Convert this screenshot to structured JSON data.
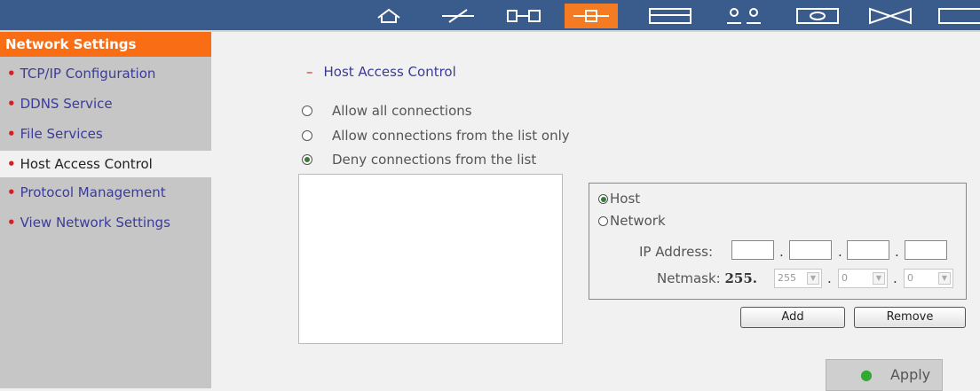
{
  "toolbar": {
    "icons": [
      "home-icon",
      "quick-config-icon",
      "system-settings-icon",
      "network-settings-icon",
      "device-config-icon",
      "user-management-icon",
      "network-share-icon",
      "system-tools-icon",
      "logs-icon"
    ],
    "active_index": 3
  },
  "sidebar": {
    "title": "Network Settings",
    "items": [
      {
        "label": "TCP/IP Configuration"
      },
      {
        "label": "DDNS Service"
      },
      {
        "label": "File Services"
      },
      {
        "label": "Host Access Control"
      },
      {
        "label": "Protocol Management"
      },
      {
        "label": "View Network Settings"
      }
    ],
    "active_index": 3
  },
  "main": {
    "title": "Host Access Control",
    "options": [
      {
        "label": "Allow all connections",
        "checked": false
      },
      {
        "label": "Allow connections from the list only",
        "checked": false
      },
      {
        "label": "Deny connections from the list",
        "checked": true
      }
    ]
  },
  "address": {
    "host_label": "Host",
    "network_label": "Network",
    "host_checked": true,
    "ip_label": "IP Address:",
    "ip_values": [
      "",
      "",
      "",
      ""
    ],
    "netmask_label": "Netmask:",
    "netmask_prefix": "255.",
    "netmask_values": [
      "255",
      "0",
      "0"
    ],
    "add_label": "Add",
    "remove_label": "Remove"
  },
  "apply_label": "Apply",
  "colors": {
    "topbar": "#3a5c8c",
    "accent": "#f96d15",
    "sidebar": "#c6c6c6",
    "link": "#3b3b9a",
    "bullet": "#d02020"
  }
}
